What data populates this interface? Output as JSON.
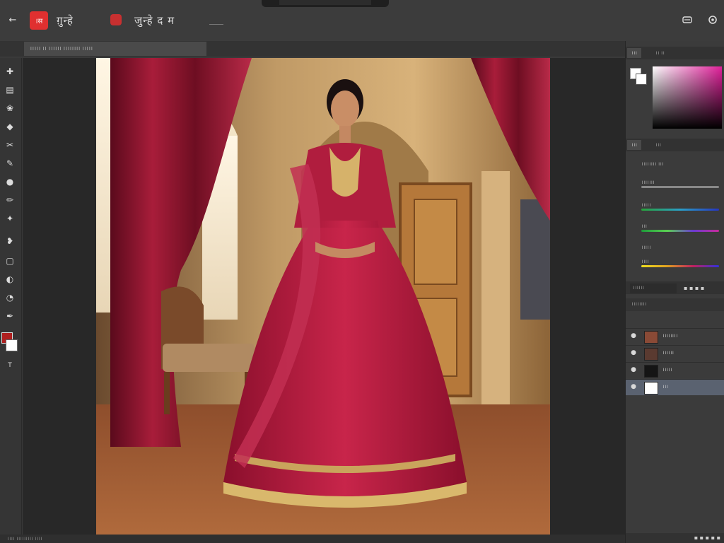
{
  "top_bar": {
    "home_glyph": "←",
    "app_icon_label": "।स",
    "menu_text": "ग़ुन्हे",
    "menu_text_2": "जुन्हे द म",
    "right_icons": [
      "layers-icon",
      "settings-icon"
    ]
  },
  "document": {
    "tab_label": "।।।।। ।। ।।।।।। ।।।।।।।। ।।।।।",
    "status_text": "।।।। ।।।।।।।।। ।।।।"
  },
  "tools": [
    {
      "name": "move-icon",
      "glyph": "✚"
    },
    {
      "name": "marquee-icon",
      "glyph": "▤"
    },
    {
      "name": "lasso-icon",
      "glyph": "❀"
    },
    {
      "name": "quick-select-icon",
      "glyph": "◆"
    },
    {
      "name": "crop-icon",
      "glyph": "✂"
    },
    {
      "name": "eyedropper-icon",
      "glyph": "✎"
    },
    {
      "name": "healing-icon",
      "glyph": "●"
    },
    {
      "name": "brush-icon",
      "glyph": "✏"
    },
    {
      "name": "stamp-icon",
      "glyph": "✦"
    },
    {
      "name": "history-brush-icon",
      "glyph": "❥"
    },
    {
      "name": "eraser-icon",
      "glyph": "▢"
    },
    {
      "name": "gradient-icon",
      "glyph": "◐"
    },
    {
      "name": "dodge-icon",
      "glyph": "◔"
    },
    {
      "name": "pen-icon",
      "glyph": "✒"
    },
    {
      "name": "text-icon",
      "glyph": "T"
    }
  ],
  "colors": {
    "foreground": "#b02020",
    "background": "#ffffff",
    "app_badge": "#e03030"
  },
  "right_panel": {
    "color_tabs": [
      "।।।",
      "।। ।।"
    ],
    "adjust_tabs": [
      "।।।",
      "।।।"
    ],
    "adjust_rows": [
      {
        "label": "।।।।।।।। ।।।"
      },
      {
        "label": "।।।।।।।"
      },
      {
        "label": "।।।।।"
      },
      {
        "label": "।।।"
      },
      {
        "label": "।।।।।"
      },
      {
        "label": "।।।।"
      }
    ],
    "layers_header": "।।।।।।",
    "layers_subheader": "।।।।।।।।",
    "layers": [
      {
        "name": "।।।।।।।।",
        "thumb": "#8a4a36",
        "selected": false
      },
      {
        "name": "।।।।।।",
        "thumb": "#5a3a30",
        "selected": false
      },
      {
        "name": "।।।।।",
        "thumb": "#151515",
        "selected": false
      },
      {
        "name": "।।।",
        "thumb": "#ffffff",
        "selected": true
      }
    ]
  }
}
